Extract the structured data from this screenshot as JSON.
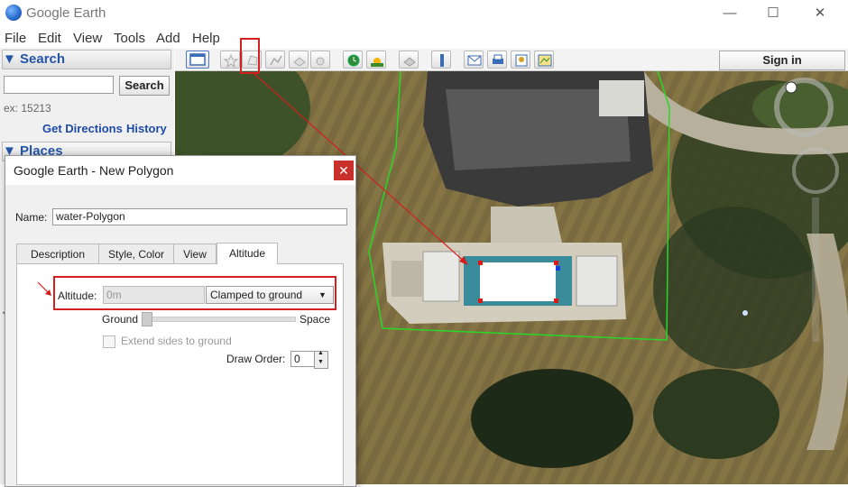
{
  "window": {
    "title": "Google Earth",
    "minimize_glyph": "—",
    "maximize_glyph": "☐",
    "close_glyph": "✕"
  },
  "menu": [
    "File",
    "Edit",
    "View",
    "Tools",
    "Add",
    "Help"
  ],
  "search": {
    "header": "Search",
    "button": "Search",
    "hint": "ex: 15213",
    "get_directions": "Get Directions",
    "history": "History"
  },
  "places": {
    "header": "Places"
  },
  "toolbar": {
    "sign_in": "Sign in",
    "icons": [
      "sidebar-icon",
      "placemark-icon",
      "polygon-icon",
      "path-icon",
      "image-overlay-icon",
      "record-tour-icon",
      "historical-imagery-icon",
      "sunlight-icon",
      "planets-icon",
      "ruler-icon",
      "email-icon",
      "print-icon",
      "save-image-icon",
      "view-in-maps-icon"
    ]
  },
  "dialog": {
    "title": "Google Earth - New Polygon",
    "close_glyph": "✕",
    "name_label": "Name:",
    "name_value": "water-Polygon",
    "tabs": [
      "Description",
      "Style, Color",
      "View",
      "Altitude"
    ],
    "active_tab": "Altitude",
    "altitude_label": "Altitude:",
    "altitude_value": "0m",
    "altitude_mode": "Clamped to ground",
    "slider_min_label": "Ground",
    "slider_max_label": "Space",
    "extend_sides_label": "Extend sides to ground",
    "extend_sides_checked": false,
    "draw_order_label": "Draw Order:",
    "draw_order_value": "0"
  },
  "colors": {
    "annotation_red": "#d21f1f",
    "polygon_outline": "#27d827",
    "link_blue": "#1e4aa8",
    "header_blue": "#2555a8"
  }
}
